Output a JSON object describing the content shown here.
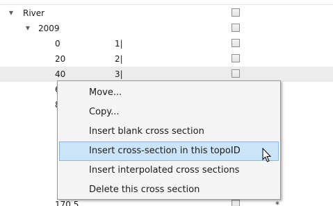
{
  "tree": {
    "root": {
      "label": "River",
      "expander": "▼"
    },
    "child": {
      "label": "2009",
      "expander": "▼"
    },
    "rows": [
      {
        "chainage": "0",
        "id": "1|"
      },
      {
        "chainage": "20",
        "id": "2|"
      },
      {
        "chainage": "40",
        "id": "3|"
      },
      {
        "chainage": "6",
        "id": ""
      },
      {
        "chainage": "8",
        "id": ""
      }
    ],
    "bottom_row": {
      "chainage": "170.5",
      "marker": "*"
    }
  },
  "context_menu": {
    "items": [
      {
        "label": "Move..."
      },
      {
        "label": "Copy..."
      },
      {
        "label": "Insert blank cross section"
      },
      {
        "label": "Insert cross-section in this topoID"
      },
      {
        "label": "Insert interpolated cross sections"
      },
      {
        "label": "Delete this cross section"
      }
    ],
    "highlighted_index": 3
  },
  "colors": {
    "menu_highlight": "#cce4f7",
    "menu_highlight_border": "#86b8e4",
    "row_selected": "#ececec"
  }
}
